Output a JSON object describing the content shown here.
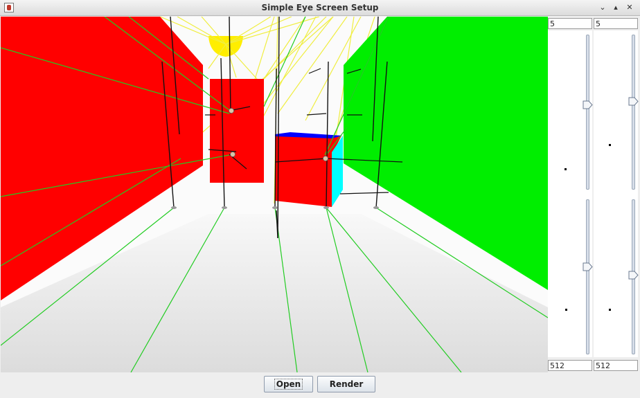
{
  "window": {
    "title": "Simple Eye Screen Setup",
    "controls": {
      "minimize": "⌄",
      "maximize": "▴",
      "close": "✕"
    }
  },
  "side_panel": {
    "top_left_value": "5",
    "top_right_value": "5",
    "bottom_left_value": "512",
    "bottom_right_value": "512",
    "sliders": [
      {
        "id": "left-upper",
        "level": 0.45
      },
      {
        "id": "right-upper",
        "level": 0.43
      },
      {
        "id": "left-lower",
        "level": 0.43
      },
      {
        "id": "right-lower",
        "level": 0.48
      }
    ]
  },
  "buttons": {
    "open_label": "Open",
    "render_label": "Render"
  },
  "colors": {
    "wall_red": "#ff0000",
    "wall_green": "#00ee00",
    "light_yellow": "#ffee00",
    "cube_cyan": "#00ffff",
    "cube_blue": "#0000ff",
    "ray_green": "#22cc22",
    "ray_yellow": "#eeee33"
  }
}
